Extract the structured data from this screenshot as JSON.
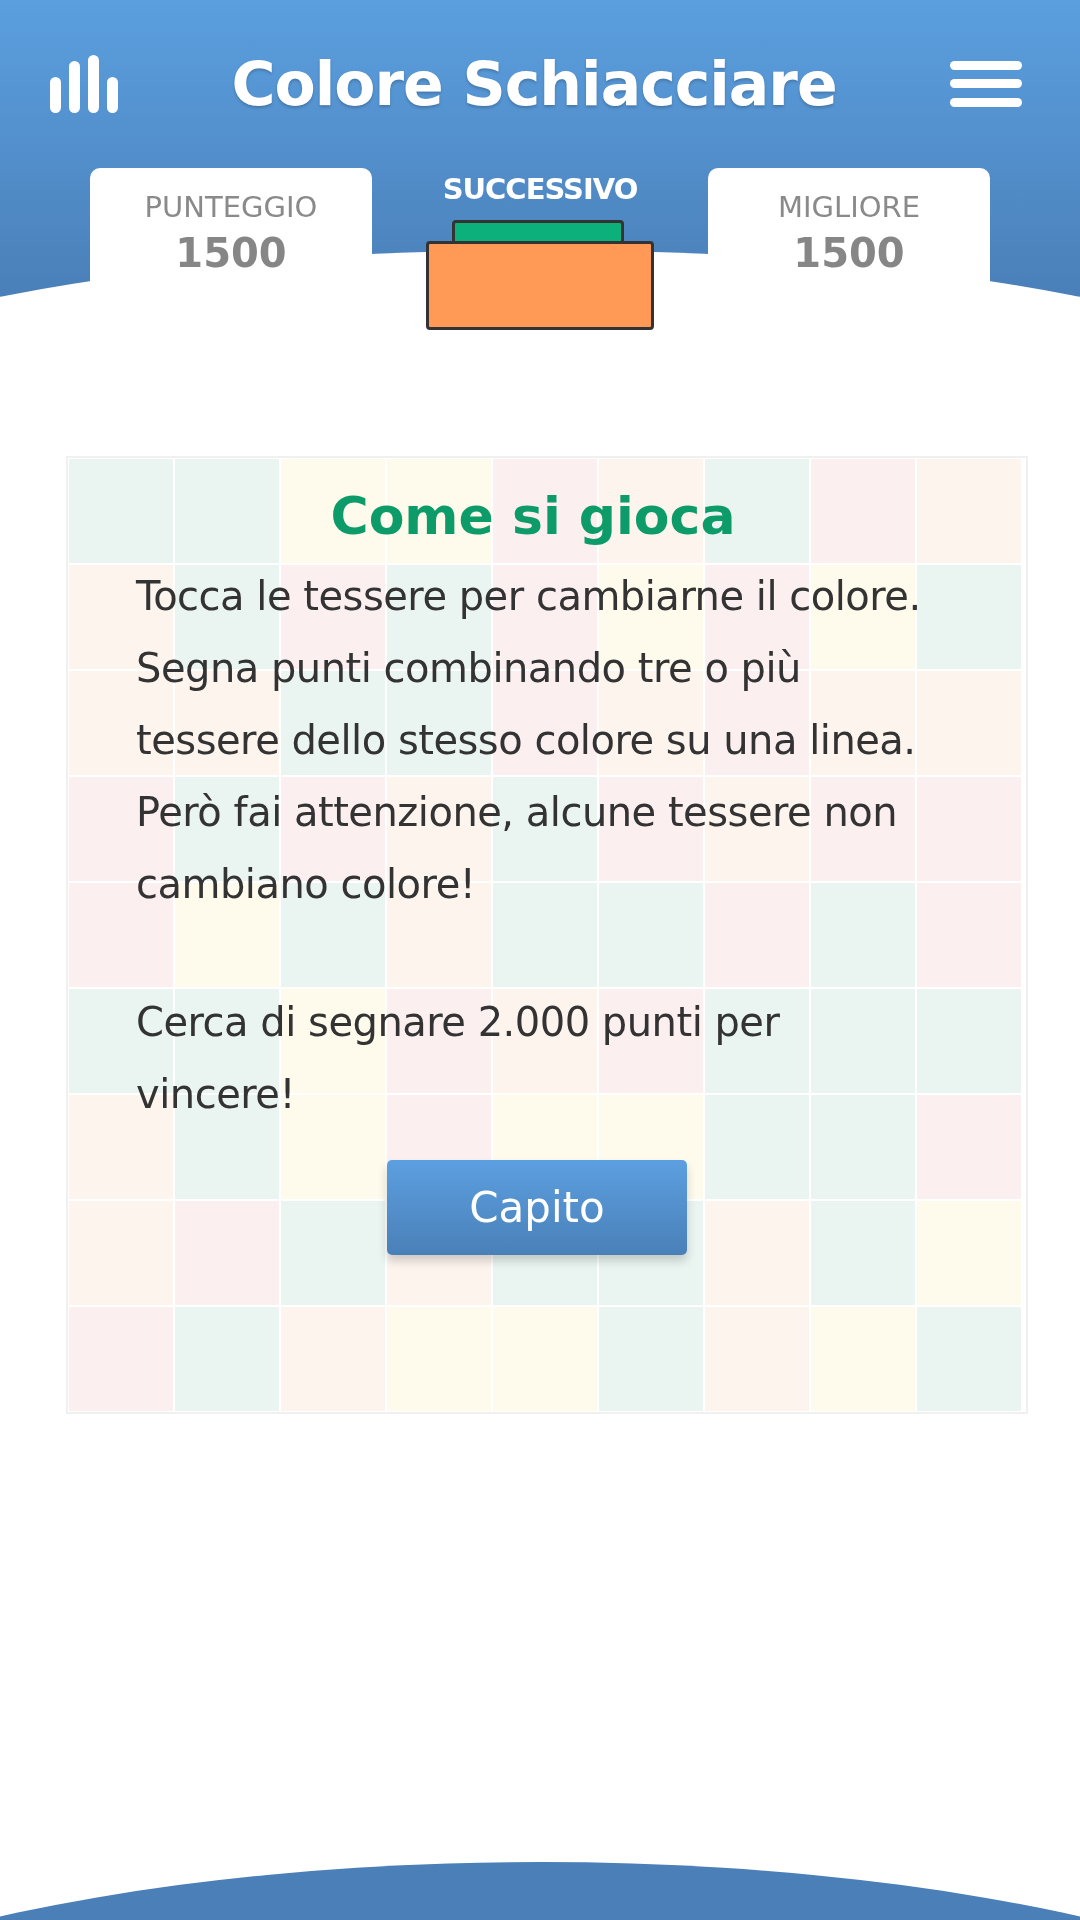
{
  "header": {
    "title": "Colore Schiacciare"
  },
  "scores": [
    {
      "label": "PUNTEGGIO",
      "value": "1500"
    },
    {
      "label": "MIGLIORE",
      "value": "1500"
    }
  ],
  "next": {
    "label": "SUCCESSIVO",
    "blocks": [
      {
        "kind": "back",
        "color": "#0bb07a"
      },
      {
        "kind": "front",
        "color": "#ff9955"
      }
    ]
  },
  "board": {
    "rows": [
      {
        "tiles": [
          {
            "color": "#eaf5f1"
          },
          {
            "color": "#eaf5f1"
          },
          {
            "color": "#fffbec"
          },
          {
            "color": "#fffbec"
          },
          {
            "color": "#fcefef"
          },
          {
            "color": "#fdf4ee"
          },
          {
            "color": "#eaf5f1"
          },
          {
            "color": "#fcefef"
          },
          {
            "color": "#fdf4ee"
          }
        ]
      },
      {
        "tiles": [
          {
            "color": "#fdf4ee"
          },
          {
            "color": "#eaf5f1"
          },
          {
            "color": "#fcefef"
          },
          {
            "color": "#eaf5f1"
          },
          {
            "color": "#fcefef"
          },
          {
            "color": "#fffbec"
          },
          {
            "color": "#fcefef"
          },
          {
            "color": "#fffbec"
          },
          {
            "color": "#eaf5f1"
          }
        ]
      },
      {
        "tiles": [
          {
            "color": "#fdf4ee"
          },
          {
            "color": "#fdf4ee"
          },
          {
            "color": "#eaf5f1"
          },
          {
            "color": "#eaf5f1"
          },
          {
            "color": "#fcefef"
          },
          {
            "color": "#fdf4ee"
          },
          {
            "color": "#fcefef"
          },
          {
            "color": "#fdf4ee"
          },
          {
            "color": "#fdf4ee"
          }
        ]
      },
      {
        "tiles": [
          {
            "color": "#fcefef"
          },
          {
            "color": "#eaf5f1"
          },
          {
            "color": "#fcefef"
          },
          {
            "color": "#fdf4ee"
          },
          {
            "color": "#eaf5f1"
          },
          {
            "color": "#fcefef"
          },
          {
            "color": "#fdf4ee"
          },
          {
            "color": "#fcefef"
          },
          {
            "color": "#fcefef"
          }
        ]
      },
      {
        "tiles": [
          {
            "color": "#fcefef"
          },
          {
            "color": "#fffbec"
          },
          {
            "color": "#eaf5f1"
          },
          {
            "color": "#fdf4ee"
          },
          {
            "color": "#eaf5f1"
          },
          {
            "color": "#eaf5f1"
          },
          {
            "color": "#fcefef"
          },
          {
            "color": "#eaf5f1"
          },
          {
            "color": "#fcefef"
          }
        ]
      },
      {
        "tiles": [
          {
            "color": "#eaf5f1"
          },
          {
            "color": "#eaf5f1"
          },
          {
            "color": "#fffbec"
          },
          {
            "color": "#fcefef"
          },
          {
            "color": "#fdf4ee"
          },
          {
            "color": "#fcefef"
          },
          {
            "color": "#eaf5f1"
          },
          {
            "color": "#eaf5f1"
          },
          {
            "color": "#eaf5f1"
          }
        ]
      },
      {
        "tiles": [
          {
            "color": "#fdf4ee"
          },
          {
            "color": "#eaf5f1"
          },
          {
            "color": "#fffbec"
          },
          {
            "color": "#fcefef"
          },
          {
            "color": "#fffbec"
          },
          {
            "color": "#fffbec"
          },
          {
            "color": "#eaf5f1"
          },
          {
            "color": "#eaf5f1"
          },
          {
            "color": "#fcefef"
          }
        ]
      },
      {
        "tiles": [
          {
            "color": "#fdf4ee"
          },
          {
            "color": "#fcefef"
          },
          {
            "color": "#eaf5f1"
          },
          {
            "color": "#fdf4ee"
          },
          {
            "color": "#eaf5f1"
          },
          {
            "color": "#eaf5f1"
          },
          {
            "color": "#fdf4ee"
          },
          {
            "color": "#eaf5f1"
          },
          {
            "color": "#fffbec"
          }
        ]
      },
      {
        "tiles": [
          {
            "color": "#fcefef"
          },
          {
            "color": "#eaf5f1"
          },
          {
            "color": "#fdf4ee"
          },
          {
            "color": "#fffbec"
          },
          {
            "color": "#fffbec"
          },
          {
            "color": "#eaf5f1"
          },
          {
            "color": "#fdf4ee"
          },
          {
            "color": "#fffbec"
          },
          {
            "color": "#eaf5f1"
          }
        ]
      }
    ]
  },
  "dialog": {
    "title": "Come si gioca",
    "paragraphs": [
      "Tocca le tessere per cambiarne il colore. Segna punti combinando tre o più tessere dello stesso colore su una linea. Però fai attenzione, alcune tessere non cambiano colore!",
      "Cerca di segnare 2.000 punti per vincere!"
    ],
    "button": "Capito"
  }
}
